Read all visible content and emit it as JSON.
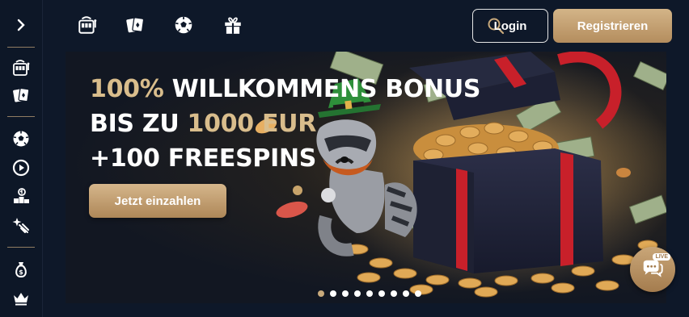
{
  "sidebar": {
    "expand_icon": "chevron-right-icon",
    "items": [
      {
        "icon": "slot-machine-icon"
      },
      {
        "icon": "playing-cards-icon"
      },
      {
        "icon": "soccer-ball-icon"
      },
      {
        "icon": "play-circle-icon"
      },
      {
        "icon": "podium-icon"
      },
      {
        "icon": "sparkle-sport-icon"
      },
      {
        "icon": "money-bag-icon"
      },
      {
        "icon": "crown-icon"
      }
    ]
  },
  "topbar": {
    "categories": [
      {
        "icon": "slot-machine-icon"
      },
      {
        "icon": "playing-cards-icon"
      },
      {
        "icon": "soccer-ball-icon"
      },
      {
        "icon": "gift-icon"
      }
    ],
    "search_icon": "search-icon",
    "login_label": "Login",
    "register_label": "Registrieren"
  },
  "banner": {
    "line1_highlight": "100%",
    "line1_rest": " WILLKOMMENS BONUS",
    "line2_start": "BIS ZU ",
    "line2_highlight": "1000 EUR",
    "line3": "+100 FREESPINS",
    "cta_label": "Jetzt einzahlen",
    "slides_count": 9,
    "active_slide": 0
  },
  "live_chat": {
    "badge": "LIVE",
    "icon": "chat-bubbles-icon"
  },
  "colors": {
    "background": "#0e1829",
    "accent_gold": "#c9aa7c",
    "headline_gold": "#d9bd8c",
    "text": "#ffffff"
  }
}
